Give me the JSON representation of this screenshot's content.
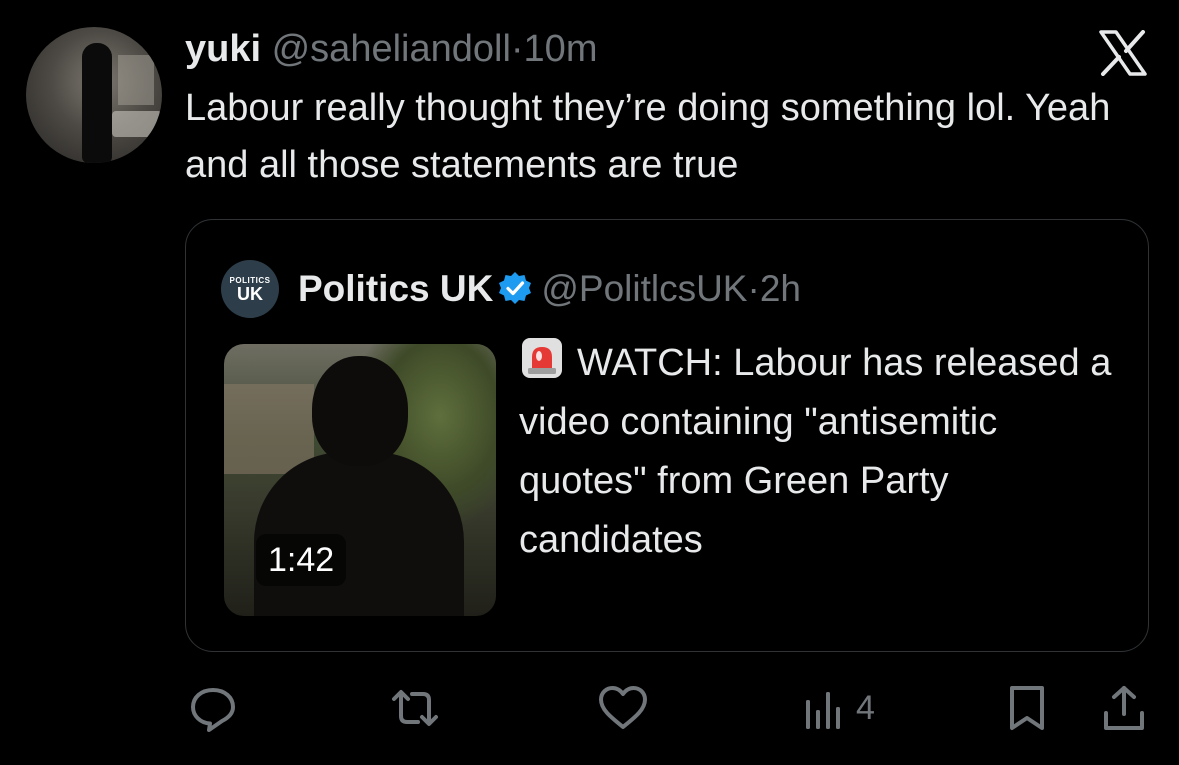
{
  "tweet": {
    "author_name": "yuki",
    "handle": "@saheliandoll",
    "separator": "·",
    "time": "10m",
    "text": "Labour really thought they’re doing something lol. Yeah and all those statements are true"
  },
  "quote": {
    "author_name": "Politics UK",
    "avatar_small": "POLITICS",
    "avatar_big": "UK",
    "handle": "@PolitlcsUK",
    "separator": "·",
    "time": "2h",
    "media_duration": "1:42",
    "text": "WATCH: Labour has released a video containing \"antisemitic quotes\" from Green Party candidates",
    "emoji_icon": "police-siren-icon"
  },
  "actions": {
    "views_count": "4"
  },
  "colors": {
    "background": "#000000",
    "text_primary": "#e7e9ea",
    "text_secondary": "#71767b",
    "border": "#2f3336",
    "verified_blue": "#1d9bf0"
  }
}
